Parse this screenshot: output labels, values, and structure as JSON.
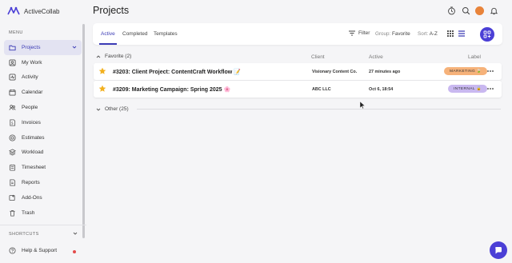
{
  "app": {
    "brand": "ActiveCollab"
  },
  "sidebar": {
    "menu_label": "MENU",
    "items": [
      {
        "label": "Projects",
        "icon": "folder-icon",
        "active": true
      },
      {
        "label": "My Work",
        "icon": "user-square-icon"
      },
      {
        "label": "Activity",
        "icon": "activity-icon"
      },
      {
        "label": "Calendar",
        "icon": "calendar-icon"
      },
      {
        "label": "People",
        "icon": "people-icon"
      },
      {
        "label": "Invoices",
        "icon": "invoice-icon"
      },
      {
        "label": "Estimates",
        "icon": "estimate-icon"
      },
      {
        "label": "Workload",
        "icon": "workload-icon"
      },
      {
        "label": "Timesheet",
        "icon": "timesheet-icon"
      },
      {
        "label": "Reports",
        "icon": "reports-icon"
      },
      {
        "label": "Add-Ons",
        "icon": "addons-icon"
      },
      {
        "label": "Trash",
        "icon": "trash-icon"
      }
    ],
    "shortcuts_label": "SHORTCUTS",
    "help_label": "Help & Support"
  },
  "header": {
    "title": "Projects"
  },
  "toolbar": {
    "tabs": [
      {
        "label": "Active",
        "active": true
      },
      {
        "label": "Completed"
      },
      {
        "label": "Templates"
      }
    ],
    "filter_label": "Filter",
    "group_prefix": "Group:",
    "group_value": "Favorite",
    "sort_prefix": "Sort:",
    "sort_value": "A-Z"
  },
  "table": {
    "group_favorite": "Favorite (2)",
    "columns": {
      "client": "Client",
      "active": "Active",
      "label": "Label"
    },
    "rows": [
      {
        "name": "#3203: Client Project: ContentCraft Workflow 📝",
        "client": "Visionary Content Co.",
        "active": "27 minutes ago",
        "label": "MARKETING 🍃",
        "label_color": "#f6b27a"
      },
      {
        "name": "#3209: Marketing Campaign: Spring 2025 🌸",
        "client": "ABC LLC",
        "active": "Oct 6, 18:54",
        "label": "INTERNAL 🔒",
        "label_color": "#c9b8f0"
      }
    ],
    "group_other": "Other (25)"
  },
  "colors": {
    "accent": "#3b3bb5",
    "button": "#4b3fd6",
    "star": "#f2b01e"
  }
}
